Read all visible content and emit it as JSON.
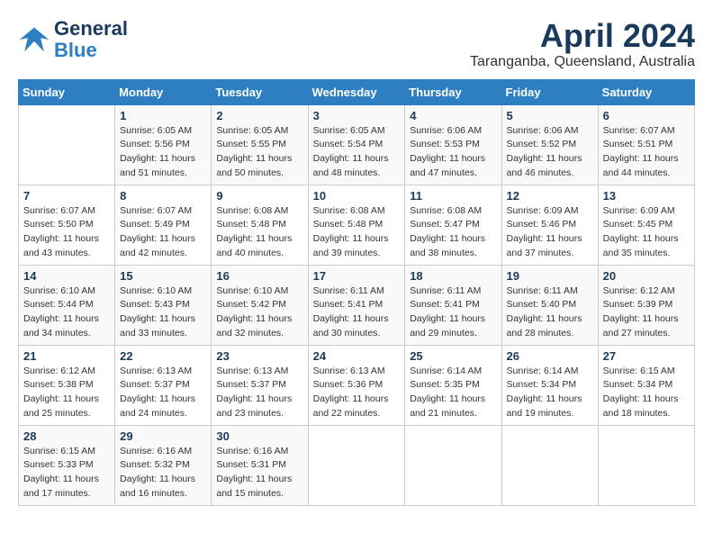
{
  "header": {
    "logo_line1": "General",
    "logo_line2": "Blue",
    "title": "April 2024",
    "subtitle": "Taranganba, Queensland, Australia"
  },
  "calendar": {
    "days_of_week": [
      "Sunday",
      "Monday",
      "Tuesday",
      "Wednesday",
      "Thursday",
      "Friday",
      "Saturday"
    ],
    "weeks": [
      [
        {
          "day": "",
          "info": ""
        },
        {
          "day": "1",
          "info": "Sunrise: 6:05 AM\nSunset: 5:56 PM\nDaylight: 11 hours\nand 51 minutes."
        },
        {
          "day": "2",
          "info": "Sunrise: 6:05 AM\nSunset: 5:55 PM\nDaylight: 11 hours\nand 50 minutes."
        },
        {
          "day": "3",
          "info": "Sunrise: 6:05 AM\nSunset: 5:54 PM\nDaylight: 11 hours\nand 48 minutes."
        },
        {
          "day": "4",
          "info": "Sunrise: 6:06 AM\nSunset: 5:53 PM\nDaylight: 11 hours\nand 47 minutes."
        },
        {
          "day": "5",
          "info": "Sunrise: 6:06 AM\nSunset: 5:52 PM\nDaylight: 11 hours\nand 46 minutes."
        },
        {
          "day": "6",
          "info": "Sunrise: 6:07 AM\nSunset: 5:51 PM\nDaylight: 11 hours\nand 44 minutes."
        }
      ],
      [
        {
          "day": "7",
          "info": "Sunrise: 6:07 AM\nSunset: 5:50 PM\nDaylight: 11 hours\nand 43 minutes."
        },
        {
          "day": "8",
          "info": "Sunrise: 6:07 AM\nSunset: 5:49 PM\nDaylight: 11 hours\nand 42 minutes."
        },
        {
          "day": "9",
          "info": "Sunrise: 6:08 AM\nSunset: 5:48 PM\nDaylight: 11 hours\nand 40 minutes."
        },
        {
          "day": "10",
          "info": "Sunrise: 6:08 AM\nSunset: 5:48 PM\nDaylight: 11 hours\nand 39 minutes."
        },
        {
          "day": "11",
          "info": "Sunrise: 6:08 AM\nSunset: 5:47 PM\nDaylight: 11 hours\nand 38 minutes."
        },
        {
          "day": "12",
          "info": "Sunrise: 6:09 AM\nSunset: 5:46 PM\nDaylight: 11 hours\nand 37 minutes."
        },
        {
          "day": "13",
          "info": "Sunrise: 6:09 AM\nSunset: 5:45 PM\nDaylight: 11 hours\nand 35 minutes."
        }
      ],
      [
        {
          "day": "14",
          "info": "Sunrise: 6:10 AM\nSunset: 5:44 PM\nDaylight: 11 hours\nand 34 minutes."
        },
        {
          "day": "15",
          "info": "Sunrise: 6:10 AM\nSunset: 5:43 PM\nDaylight: 11 hours\nand 33 minutes."
        },
        {
          "day": "16",
          "info": "Sunrise: 6:10 AM\nSunset: 5:42 PM\nDaylight: 11 hours\nand 32 minutes."
        },
        {
          "day": "17",
          "info": "Sunrise: 6:11 AM\nSunset: 5:41 PM\nDaylight: 11 hours\nand 30 minutes."
        },
        {
          "day": "18",
          "info": "Sunrise: 6:11 AM\nSunset: 5:41 PM\nDaylight: 11 hours\nand 29 minutes."
        },
        {
          "day": "19",
          "info": "Sunrise: 6:11 AM\nSunset: 5:40 PM\nDaylight: 11 hours\nand 28 minutes."
        },
        {
          "day": "20",
          "info": "Sunrise: 6:12 AM\nSunset: 5:39 PM\nDaylight: 11 hours\nand 27 minutes."
        }
      ],
      [
        {
          "day": "21",
          "info": "Sunrise: 6:12 AM\nSunset: 5:38 PM\nDaylight: 11 hours\nand 25 minutes."
        },
        {
          "day": "22",
          "info": "Sunrise: 6:13 AM\nSunset: 5:37 PM\nDaylight: 11 hours\nand 24 minutes."
        },
        {
          "day": "23",
          "info": "Sunrise: 6:13 AM\nSunset: 5:37 PM\nDaylight: 11 hours\nand 23 minutes."
        },
        {
          "day": "24",
          "info": "Sunrise: 6:13 AM\nSunset: 5:36 PM\nDaylight: 11 hours\nand 22 minutes."
        },
        {
          "day": "25",
          "info": "Sunrise: 6:14 AM\nSunset: 5:35 PM\nDaylight: 11 hours\nand 21 minutes."
        },
        {
          "day": "26",
          "info": "Sunrise: 6:14 AM\nSunset: 5:34 PM\nDaylight: 11 hours\nand 19 minutes."
        },
        {
          "day": "27",
          "info": "Sunrise: 6:15 AM\nSunset: 5:34 PM\nDaylight: 11 hours\nand 18 minutes."
        }
      ],
      [
        {
          "day": "28",
          "info": "Sunrise: 6:15 AM\nSunset: 5:33 PM\nDaylight: 11 hours\nand 17 minutes."
        },
        {
          "day": "29",
          "info": "Sunrise: 6:16 AM\nSunset: 5:32 PM\nDaylight: 11 hours\nand 16 minutes."
        },
        {
          "day": "30",
          "info": "Sunrise: 6:16 AM\nSunset: 5:31 PM\nDaylight: 11 hours\nand 15 minutes."
        },
        {
          "day": "",
          "info": ""
        },
        {
          "day": "",
          "info": ""
        },
        {
          "day": "",
          "info": ""
        },
        {
          "day": "",
          "info": ""
        }
      ]
    ]
  }
}
